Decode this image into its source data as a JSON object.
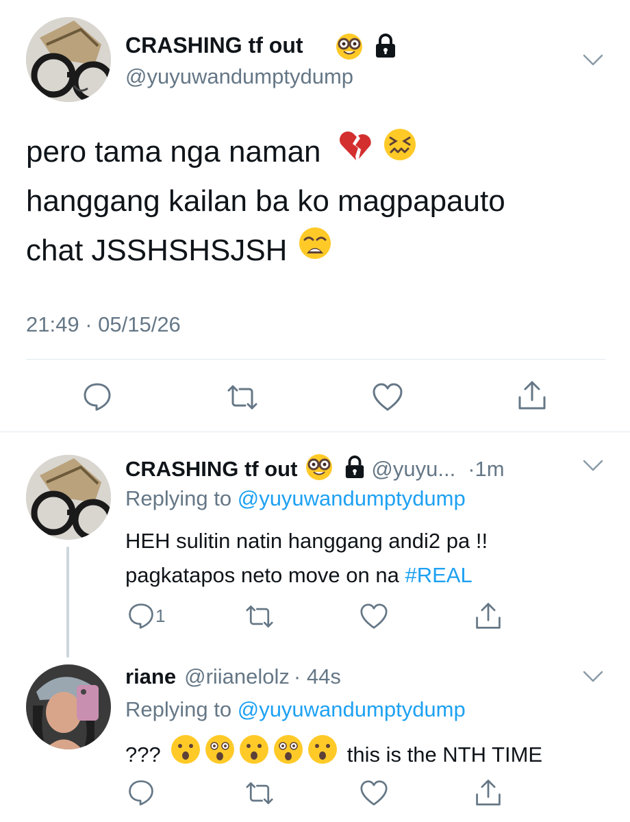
{
  "main_tweet": {
    "display_name": "CRASHING tf out",
    "handle": "@yuyuwandumptydump",
    "lines": [
      "pero tama nga naman",
      "hanggang kailan ba ko magpapauto",
      "chat JSSHSHSJSH"
    ],
    "timestamp": "21:49 · 05/15/26",
    "icons": [
      "nerd-face-emoji",
      "lock-icon",
      "chevron-down-icon",
      "reply-icon",
      "retweet-icon",
      "like-icon",
      "share-icon"
    ]
  },
  "reply1": {
    "display_name": "CRASHING tf out",
    "handle": "@yuyu...",
    "time": "·1m",
    "replying_to_label": "Replying to",
    "replying_to_handle": "@yuyuwandumptydump",
    "line1": "HEH sulitin natin hanggang andi2 pa !!",
    "line2_text": "pagkatapos neto move on na",
    "hashtag": "#REAL",
    "reply_count": "1"
  },
  "reply2": {
    "display_name": "riane",
    "handle": "@riianelolz",
    "time": "· 44s",
    "replying_to_label": "Replying to",
    "replying_to_handle": "@yuyuwandumptydump",
    "prefix": "???",
    "suffix": "this is the NTH TIME"
  },
  "colors": {
    "link": "#1da1f2",
    "secondary": "#657786",
    "divider": "#e1e8ed",
    "primary": "#0f1419"
  }
}
